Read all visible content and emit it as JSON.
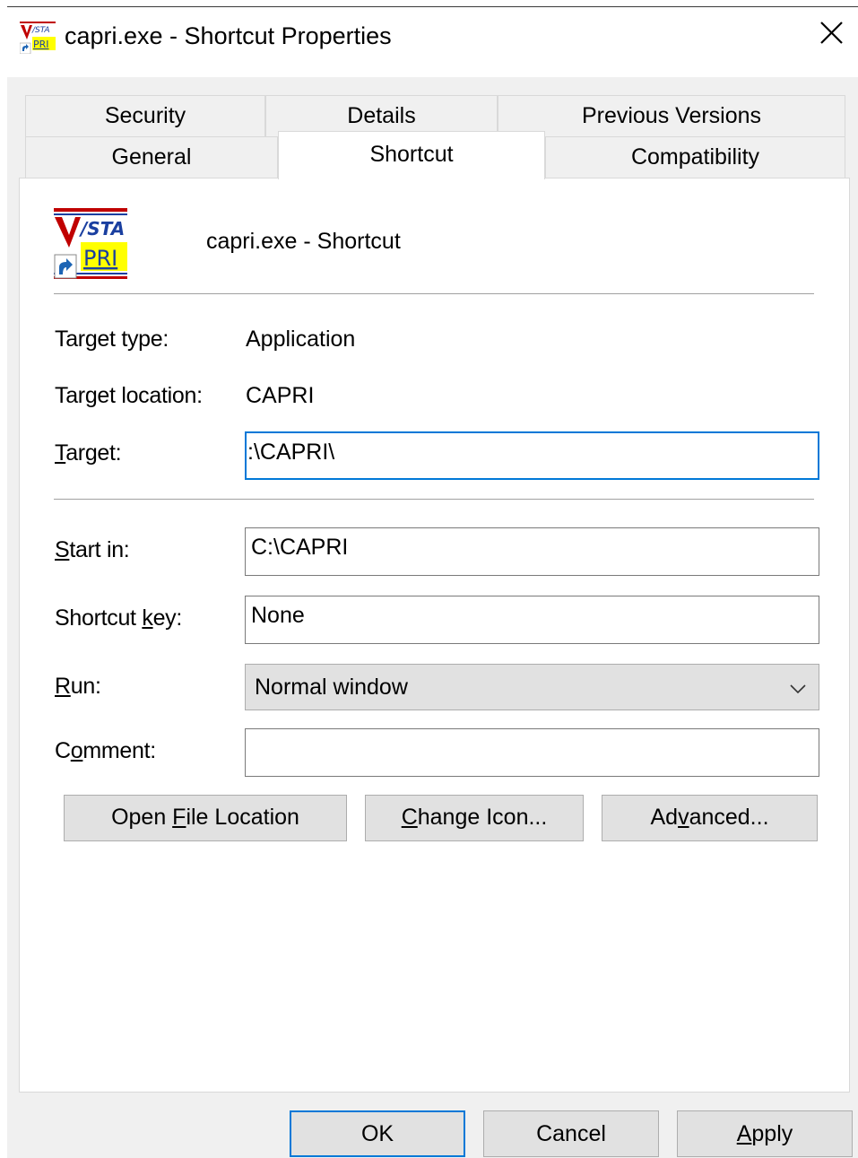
{
  "window": {
    "title": "capri.exe - Shortcut Properties",
    "close_glyph": "✕"
  },
  "tabs": {
    "row1": [
      {
        "label": "Security"
      },
      {
        "label": "Details"
      },
      {
        "label": "Previous Versions"
      }
    ],
    "row2": [
      {
        "label": "General"
      },
      {
        "label": "Shortcut",
        "active": true
      },
      {
        "label": "Compatibility"
      }
    ]
  },
  "shortcut": {
    "name": "capri.exe - Shortcut",
    "icon": "vista-capri-app-icon",
    "target_type_label": "Target type:",
    "target_type_value": "Application",
    "target_location_label": "Target location:",
    "target_location_value": "CAPRI",
    "target_label_accel": "T",
    "target_label_rest": "arget:",
    "target_value": ":\\CAPRI\\",
    "start_in_label_accel": "S",
    "start_in_label_rest": "tart in:",
    "start_in_value": "C:\\CAPRI",
    "shortcut_key_label_pre": "Shortcut ",
    "shortcut_key_label_accel": "k",
    "shortcut_key_label_rest": "ey:",
    "shortcut_key_value": "None",
    "run_label_accel": "R",
    "run_label_rest": "un:",
    "run_value": "Normal window",
    "comment_label_pre": "C",
    "comment_label_accel": "o",
    "comment_label_rest": "mment:",
    "comment_value": ""
  },
  "actions": {
    "open_file_location_pre": "Open ",
    "open_file_location_accel": "F",
    "open_file_location_rest": "ile Location",
    "change_icon_accel": "C",
    "change_icon_rest": "hange Icon...",
    "advanced_pre": "Ad",
    "advanced_accel": "v",
    "advanced_rest": "anced..."
  },
  "footer": {
    "ok": "OK",
    "cancel": "Cancel",
    "apply_accel": "A",
    "apply_rest": "pply"
  },
  "colors": {
    "focus_accent": "#0078d7",
    "dialog_bg": "#f0f0f0",
    "button_bg": "#e1e1e1"
  }
}
